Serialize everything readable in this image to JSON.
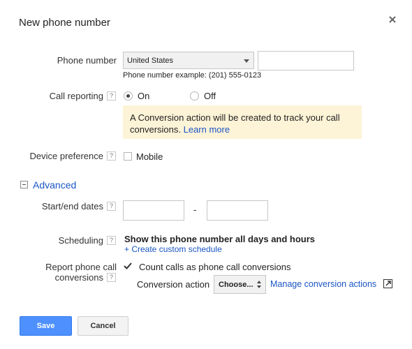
{
  "dialog": {
    "title": "New phone number",
    "close_icon": "close-icon"
  },
  "phone": {
    "label": "Phone number",
    "country_selected": "United States",
    "number_value": "",
    "example": "Phone number example: (201) 555-0123"
  },
  "call_reporting": {
    "label": "Call reporting",
    "help": "?",
    "on_label": "On",
    "off_label": "Off",
    "selected": "On",
    "info_text": "A Conversion action will be created to track your call conversions.",
    "learn_more": "Learn more"
  },
  "device": {
    "label": "Device preference",
    "help": "?",
    "mobile_label": "Mobile",
    "mobile_checked": false
  },
  "advanced": {
    "label": "Advanced",
    "expanded": true
  },
  "dates": {
    "label": "Start/end dates",
    "help": "?",
    "separator": "-",
    "start_value": "",
    "end_value": ""
  },
  "scheduling": {
    "label": "Scheduling",
    "help": "?",
    "summary": "Show this phone number all days and hours",
    "create_link": "+ Create custom schedule"
  },
  "report": {
    "label_line1": "Report phone call",
    "label_line2": "conversions",
    "help": "?",
    "count_label": "Count calls as phone call conversions",
    "count_checked": true,
    "conversion_action_label": "Conversion action",
    "choose_value": "Choose...",
    "manage_link": "Manage conversion actions"
  },
  "buttons": {
    "save": "Save",
    "cancel": "Cancel"
  },
  "colors": {
    "primary_button": "#4d90fe",
    "link": "#1a55c4",
    "info_background": "#fdf3d7"
  }
}
